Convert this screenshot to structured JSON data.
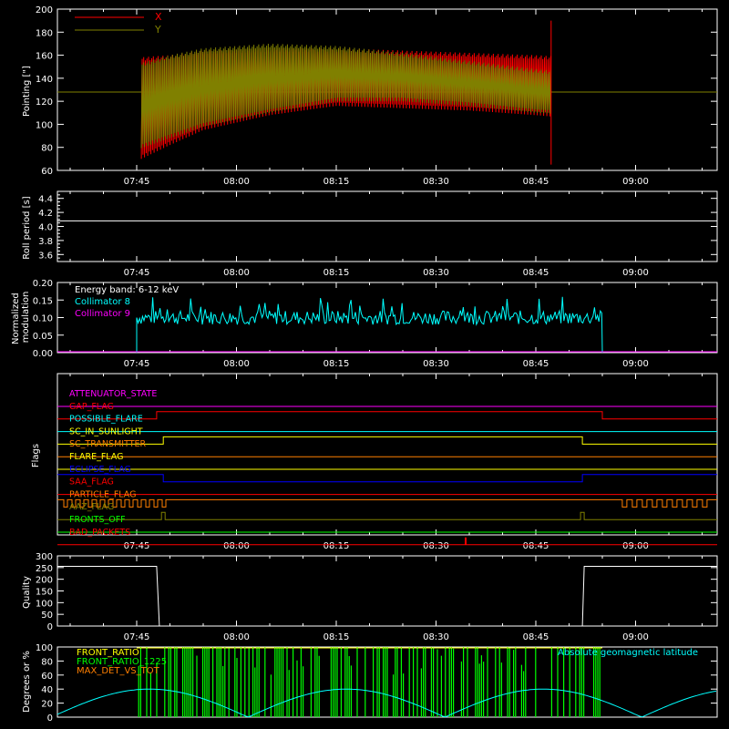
{
  "chart_data": [
    {
      "type": "line",
      "ylabel": "Pointing [\"]",
      "ylim": [
        60,
        200
      ],
      "yticks": [
        "60",
        "80",
        "100",
        "120",
        "140",
        "160",
        "180",
        "200"
      ],
      "xticks": [
        "07:45",
        "08:00",
        "08:15",
        "08:30",
        "08:45",
        "09:00"
      ],
      "legend_placement": "top-left",
      "series": [
        {
          "name": "X",
          "color": "#ff0000",
          "time_min": [
            0,
            5,
            10,
            20,
            30,
            40,
            50,
            60,
            66
          ],
          "upper": [
            158,
            160,
            164,
            166,
            166,
            164,
            162,
            160,
            158
          ],
          "lower": [
            68,
            82,
            95,
            108,
            116,
            114,
            112,
            108,
            105
          ]
        },
        {
          "name": "Y",
          "color": "#808000",
          "time_min": [
            0,
            5,
            10,
            20,
            30,
            40,
            50,
            60,
            66
          ],
          "upper": [
            152,
            160,
            166,
            170,
            168,
            162,
            155,
            148,
            145
          ],
          "lower": [
            78,
            88,
            98,
            110,
            120,
            120,
            116,
            110,
            108
          ]
        }
      ],
      "baseline": 128
    },
    {
      "type": "line",
      "ylabel": "Roll period [s]",
      "ylim": [
        3.5,
        4.5
      ],
      "yticks": [
        "3.6",
        "3.8",
        "4.0",
        "4.2",
        "4.4"
      ],
      "xticks": [
        "07:45",
        "08:00",
        "08:15",
        "08:30",
        "08:45",
        "09:00"
      ],
      "value": 4.08
    },
    {
      "type": "line",
      "ylabel": "Normalized modulation",
      "ylim": [
        0,
        0.2
      ],
      "yticks": [
        "0.00",
        "0.05",
        "0.10",
        "0.15",
        "0.20"
      ],
      "xticks": [
        "07:45",
        "08:00",
        "08:15",
        "08:30",
        "08:45",
        "09:00"
      ],
      "annotation": "Energy band: 6-12 keV",
      "series": [
        {
          "name": "Collimator 8",
          "color": "#00ffff",
          "start": "07:45",
          "end": "08:55",
          "mean": 0.1,
          "spread": 0.02
        },
        {
          "name": "Collimator 9",
          "color": "#ff00ff",
          "value": 0.0
        }
      ]
    },
    {
      "type": "line",
      "ylabel": "Flags",
      "xticks": [
        "07:45",
        "08:00",
        "08:15",
        "08:30",
        "08:45",
        "09:00"
      ],
      "flags": [
        {
          "name": "ATTENUATOR_STATE",
          "color": "#ff00ff"
        },
        {
          "name": "GAP_FLAG",
          "color": "#ff0000"
        },
        {
          "name": "POSSIBLE_FLARE",
          "color": "#00ffff"
        },
        {
          "name": "SC_IN_SUNLIGHT",
          "color": "#ffff00"
        },
        {
          "name": "SC_TRANSMITTER",
          "color": "#ff7f00"
        },
        {
          "name": "FLARE_FLAG",
          "color": "#ffff00"
        },
        {
          "name": "ECLIPSE_FLAG",
          "color": "#0000ff"
        },
        {
          "name": "SAA_FLAG",
          "color": "#ff0000"
        },
        {
          "name": "PARTICLE_FLAG",
          "color": "#ff7f00"
        },
        {
          "name": "AAZ_FLAG",
          "color": "#808000"
        },
        {
          "name": "FRONTS_OFF",
          "color": "#00ff00"
        },
        {
          "name": "BAD_PACKETS",
          "color": "#ff0000"
        }
      ]
    },
    {
      "type": "line",
      "ylabel": "Quality",
      "ylim": [
        0,
        300
      ],
      "yticks": [
        "0",
        "50",
        "100",
        "150",
        "200",
        "250",
        "300"
      ],
      "xticks": [
        "07:45",
        "08:00",
        "08:15",
        "08:30",
        "08:45",
        "09:00"
      ],
      "high": 255,
      "low": 0
    },
    {
      "type": "line",
      "ylabel": "Degrees or %",
      "ylim": [
        0,
        100
      ],
      "yticks": [
        "0",
        "20",
        "40",
        "60",
        "80",
        "100"
      ],
      "legend": [
        {
          "name": "FRONT_RATIO",
          "color": "#ffff00"
        },
        {
          "name": "FRONT_RATIO_1225",
          "color": "#00ff00"
        },
        {
          "name": "MAX_DET_VS_TOT",
          "color": "#ff7f00"
        }
      ],
      "label_right": {
        "name": "Absolute geomagnetic latitude",
        "color": "#00ffff"
      }
    }
  ]
}
